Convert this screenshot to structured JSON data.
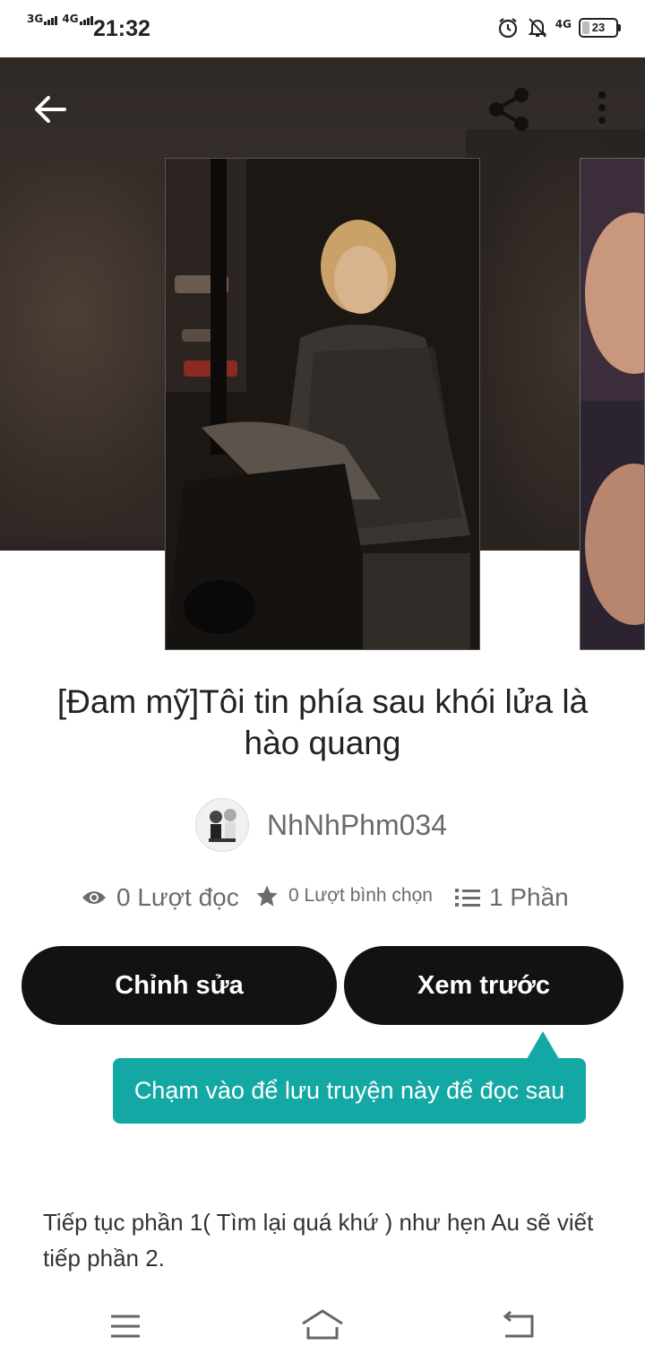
{
  "status_bar": {
    "network1": "3G",
    "network2": "4G",
    "time": "21:32",
    "network_right": "4G",
    "battery": "23",
    "icons": [
      "alarm-icon",
      "bell-off-icon",
      "signal-4g-icon",
      "battery-icon"
    ]
  },
  "header": {
    "back_icon": "back-arrow-icon",
    "share_icon": "share-icon",
    "more_icon": "more-vertical-icon"
  },
  "story": {
    "title": "[Đam mỹ]Tôi tin phía sau khói lửa là hào quang",
    "author": "NhNhPhm034",
    "reads": "0 Lượt đọc",
    "votes": "0 Lượt bình chọn",
    "parts": "1 Phần",
    "description": "Tiếp tục phần 1( Tìm lại quá khứ ) như hẹn Au sẽ viết tiếp phần 2."
  },
  "actions": {
    "edit_label": "Chỉnh sửa",
    "preview_label": "Xem trước"
  },
  "tooltip": {
    "text": "Chạm vào để lưu truyện này để đọc sau"
  },
  "colors": {
    "tooltip_bg": "#14a8a5",
    "button_bg": "#121212",
    "hero_bg": "#2f2926"
  },
  "nav_bar": {
    "icons": [
      "menu-icon",
      "home-icon",
      "back-icon"
    ]
  }
}
